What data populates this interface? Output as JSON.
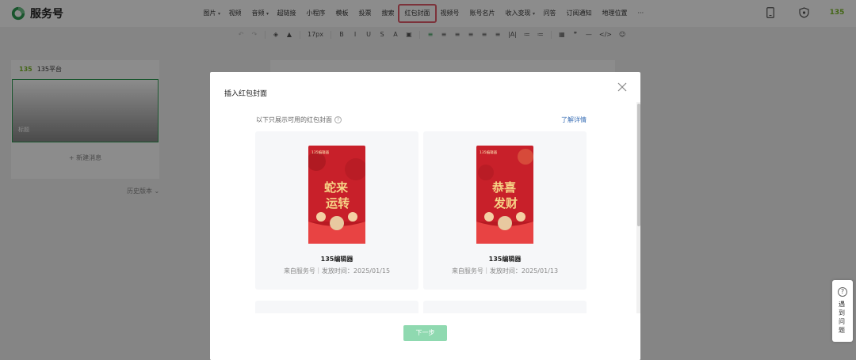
{
  "header": {
    "title": "服务号",
    "menu": [
      "图片",
      "视频",
      "音频",
      "超链接",
      "小程序",
      "模板",
      "投票",
      "搜索",
      "红包封面",
      "视频号",
      "账号名片",
      "收入变现",
      "问答",
      "订阅通知",
      "地理位置",
      "···"
    ],
    "highlighted_menu_index": 8,
    "right_icons": [
      "phone-preview-icon",
      "shield-icon",
      "135-logo-icon"
    ],
    "right_logo_text": "135"
  },
  "toolbar": {
    "items": [
      "↶",
      "↷",
      "◈",
      "▲",
      "17px",
      "B",
      "I",
      "U",
      "S",
      "A",
      "▣",
      "≡",
      "≡",
      "≡",
      "≡",
      "≡",
      "≡",
      "|A|",
      "≔",
      "≔",
      "▦",
      "❞",
      "—",
      "</>",
      "☺"
    ],
    "font_size": "17px"
  },
  "sidebar": {
    "account_name": "135平台",
    "account_logo": "135",
    "cover_title": "标题",
    "new_message": "新建消息",
    "history": "历史版本"
  },
  "modal": {
    "title": "插入红包封面",
    "hint": "以下只展示可用的红包封面",
    "learn_more": "了解详情",
    "next_button": "下一步",
    "cards": [
      {
        "name": "135编辑器",
        "meta": "来自服务号｜发放时间：2025/01/15",
        "top_label": "135编辑器",
        "calligraphy": [
          "蛇来",
          "运转"
        ]
      },
      {
        "name": "135编辑器",
        "meta": "来自服务号｜发放时间：2025/01/13",
        "top_label": "135编辑器",
        "calligraphy": [
          "恭喜",
          "发财"
        ]
      }
    ]
  },
  "help_float": {
    "label": "遇到问题"
  },
  "colors": {
    "brand_green": "#2f9b53",
    "highlight_red": "#e25b6a",
    "envelope_red": "#c8202a",
    "button_disabled": "#8fd9b0",
    "link_blue": "#3a6fb6"
  }
}
